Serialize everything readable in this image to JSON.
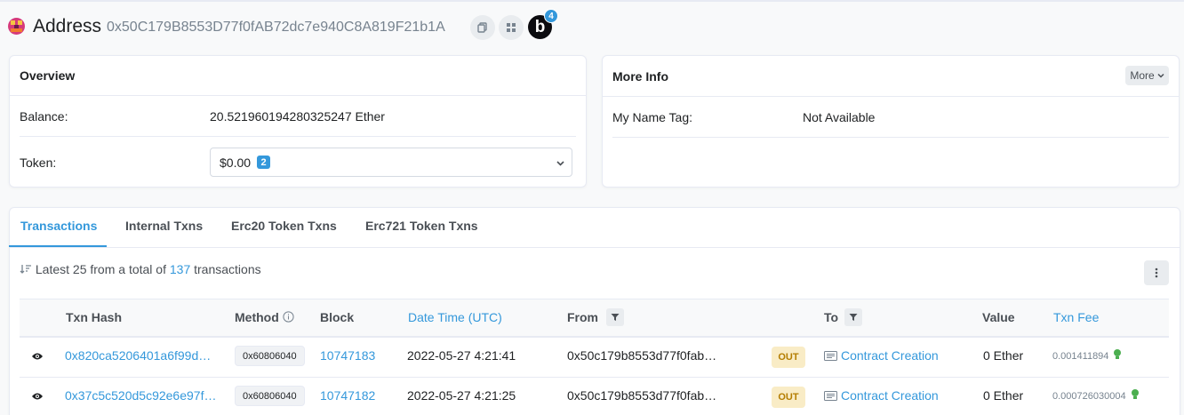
{
  "header": {
    "title": "Address",
    "address": "0x50C179B8553D77f0fAB72dc7e940C8A819F21b1A",
    "badge_letter": "b",
    "badge_count": "4"
  },
  "overview": {
    "title": "Overview",
    "balance_label": "Balance:",
    "balance_value": "20.521960194280325247 Ether",
    "token_label": "Token:",
    "token_value": "$0.00",
    "token_count": "2"
  },
  "more_info": {
    "title": "More Info",
    "more_button": "More",
    "name_tag_label": "My Name Tag:",
    "name_tag_value": "Not Available"
  },
  "tabs": [
    {
      "label": "Transactions",
      "active": true
    },
    {
      "label": "Internal Txns",
      "active": false
    },
    {
      "label": "Erc20 Token Txns",
      "active": false
    },
    {
      "label": "Erc721 Token Txns",
      "active": false
    }
  ],
  "summary": {
    "prefix": "Latest 25 from a total of",
    "count": "137",
    "suffix": "transactions"
  },
  "table": {
    "columns": {
      "txn_hash": "Txn Hash",
      "method": "Method",
      "block": "Block",
      "date_time": "Date Time (UTC)",
      "from": "From",
      "to": "To",
      "value": "Value",
      "txn_fee": "Txn Fee"
    },
    "rows": [
      {
        "hash": "0x820ca5206401a6f99d…",
        "method": "0x60806040",
        "block": "10747183",
        "date_time": "2022-05-27 4:21:41",
        "from": "0x50c179b8553d77f0fab…",
        "direction": "OUT",
        "to": "Contract Creation",
        "value": "0 Ether",
        "fee": "0.001411894"
      },
      {
        "hash": "0x37c5c520d5c92e6e97f…",
        "method": "0x60806040",
        "block": "10747182",
        "date_time": "2022-05-27 4:21:25",
        "from": "0x50c179b8553d77f0fab…",
        "direction": "OUT",
        "to": "Contract Creation",
        "value": "0 Ether",
        "fee": "0.000726030004"
      }
    ]
  },
  "colors": {
    "accent": "#3498db",
    "out_badge_bg": "#f9ecc6",
    "out_badge_text": "#b47d00",
    "fee_icon": "#4caf50"
  }
}
